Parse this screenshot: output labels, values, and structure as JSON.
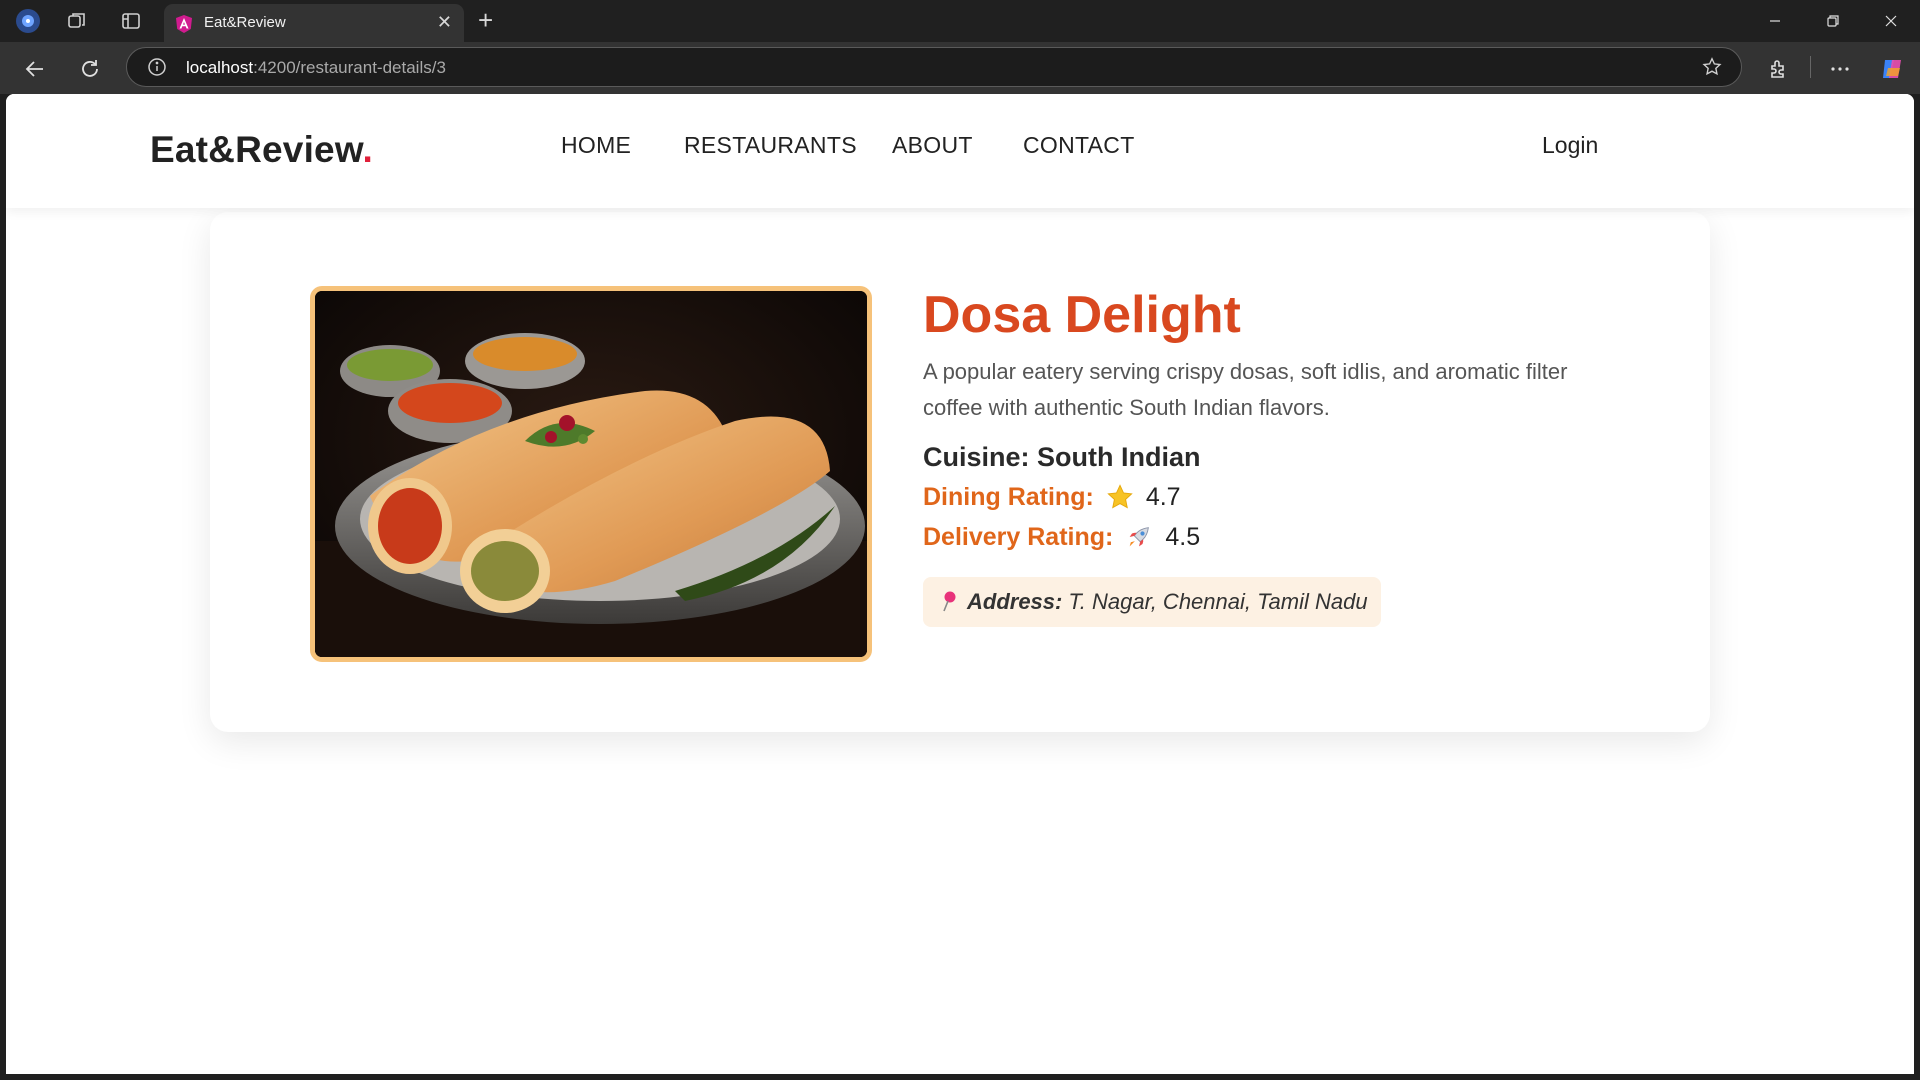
{
  "browser": {
    "tab_title": "Eat&Review",
    "url_host": "localhost",
    "url_path": ":4200/restaurant-details/3"
  },
  "site": {
    "brand_name": "Eat&Review",
    "brand_dot": ".",
    "nav": {
      "home": "HOME",
      "restaurants": "RESTAURANTS",
      "about": "ABOUT",
      "contact": "CONTACT"
    },
    "login": "Login"
  },
  "restaurant": {
    "name": "Dosa Delight",
    "description": "A popular eatery serving crispy dosas, soft idlis, and aromatic filter coffee with authentic South Indian flavors.",
    "cuisine_label": "Cuisine:",
    "cuisine": "South Indian",
    "dining_label": "Dining Rating:",
    "dining_icon": "star-emoji",
    "dining_rating": "4.7",
    "delivery_label": "Delivery Rating:",
    "delivery_icon": "rocket-emoji",
    "delivery_rating": "4.5",
    "address_icon": "pushpin-emoji",
    "address_label": "Address:",
    "address": "T. Nagar, Chennai, Tamil Nadu"
  },
  "colors": {
    "accent_title": "#d9481f",
    "rating_label": "#e0661a",
    "brand_dot": "#e0203a",
    "photo_border": "#f6c27a",
    "address_bg": "#fdf1e3"
  }
}
